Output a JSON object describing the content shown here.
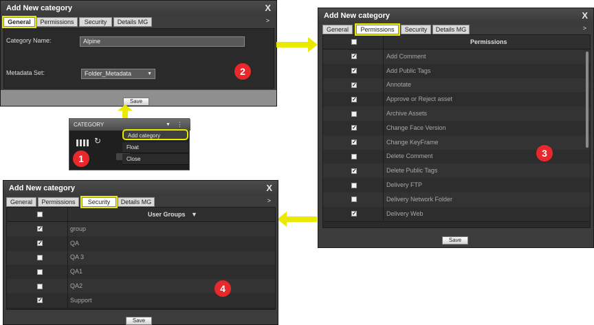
{
  "colors": {
    "highlight": "#e9e900",
    "badge": "#e8282b",
    "dialog_bg": "#3c3c3c",
    "arrow": "#eaea00"
  },
  "dialog2": {
    "title": "Add New category",
    "close": "X",
    "tabs": [
      "General",
      "Permissions",
      "Security",
      "Details MG"
    ],
    "more": ">",
    "category_label": "Category Name:",
    "category_value": "Alpine",
    "metadata_label": "Metadata Set:",
    "metadata_value": "Folder_Metadata",
    "badge": "2",
    "save": "Save"
  },
  "dialog3": {
    "title": "Add New category",
    "close": "X",
    "tabs": [
      "General",
      "Permissions",
      "Security",
      "Details MG"
    ],
    "more": ">",
    "header": "Permissions",
    "badge": "3",
    "save": "Save",
    "rows": [
      {
        "label": "Add Comment",
        "checked": true
      },
      {
        "label": "Add Public Tags",
        "checked": true
      },
      {
        "label": "Annotate",
        "checked": true
      },
      {
        "label": "Approve or Reject asset",
        "checked": true
      },
      {
        "label": "Archive Assets",
        "checked": false
      },
      {
        "label": "Change Face Version",
        "checked": true
      },
      {
        "label": "Change KeyFrame",
        "checked": true
      },
      {
        "label": "Delete Comment",
        "checked": false
      },
      {
        "label": "Delete Public Tags",
        "checked": true
      },
      {
        "label": "Delivery FTP",
        "checked": false
      },
      {
        "label": "Delivery Network Folder",
        "checked": false
      },
      {
        "label": "Delivery Web",
        "checked": true
      }
    ]
  },
  "dialog4": {
    "title": "Add New category",
    "close": "X",
    "tabs": [
      "General",
      "Permissions",
      "Security",
      "Details MG"
    ],
    "more": ">",
    "header": "User Groups",
    "sort_icon": "▼",
    "badge": "4",
    "save": "Save",
    "rows": [
      {
        "label": "group",
        "checked": true
      },
      {
        "label": "QA",
        "checked": true
      },
      {
        "label": "QA 3",
        "checked": false
      },
      {
        "label": "QA1",
        "checked": false
      },
      {
        "label": "QA2",
        "checked": false
      },
      {
        "label": "Support",
        "checked": true
      }
    ]
  },
  "category_menu": {
    "header": "CATEGORY",
    "items": [
      "Add category",
      "Float",
      "Close"
    ],
    "badge": "1"
  }
}
